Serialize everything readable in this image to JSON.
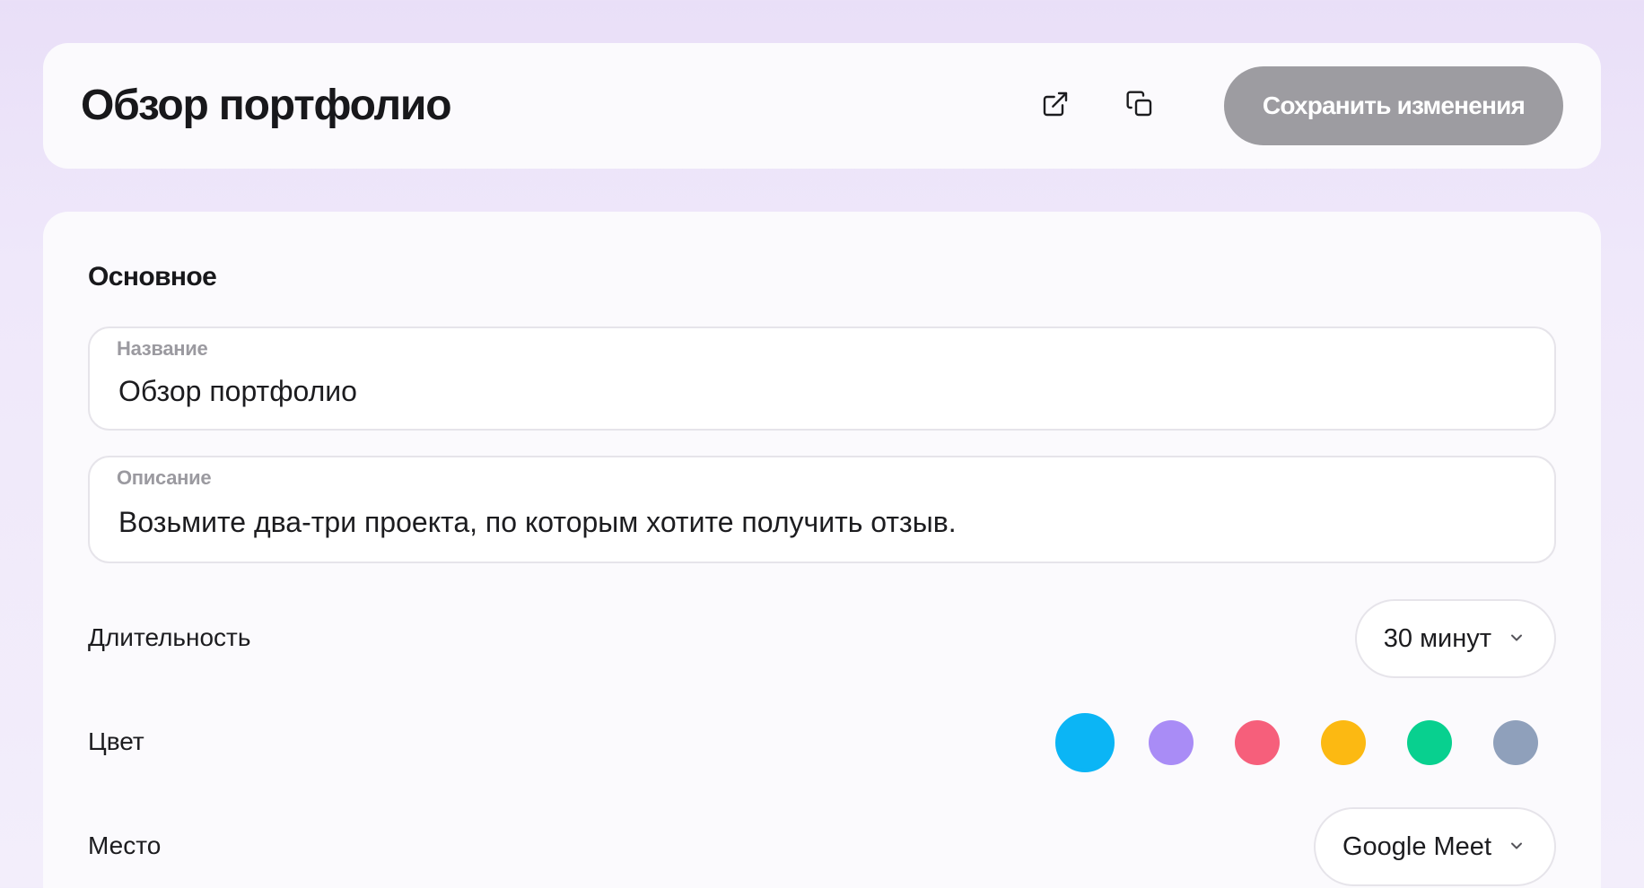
{
  "header": {
    "title": "Обзор портфолио",
    "open_icon": "external-link-icon",
    "copy_icon": "copy-icon",
    "save_label": "Сохранить изменения"
  },
  "main": {
    "section_title": "Основное",
    "name_field": {
      "label": "Название",
      "value": "Обзор портфолио"
    },
    "description_field": {
      "label": "Описание",
      "value": "Возьмите два-три проекта, по которым хотите получить отзыв."
    },
    "duration": {
      "label": "Длительность",
      "value": "30 минут"
    },
    "color": {
      "label": "Цвет",
      "selected": "#0bb5f5",
      "options": [
        "#0bb5f5",
        "#a98cf6",
        "#f65f7b",
        "#fcb912",
        "#08d08f",
        "#8fa0bb"
      ]
    },
    "location": {
      "label": "Место",
      "value": "Google Meet"
    }
  }
}
